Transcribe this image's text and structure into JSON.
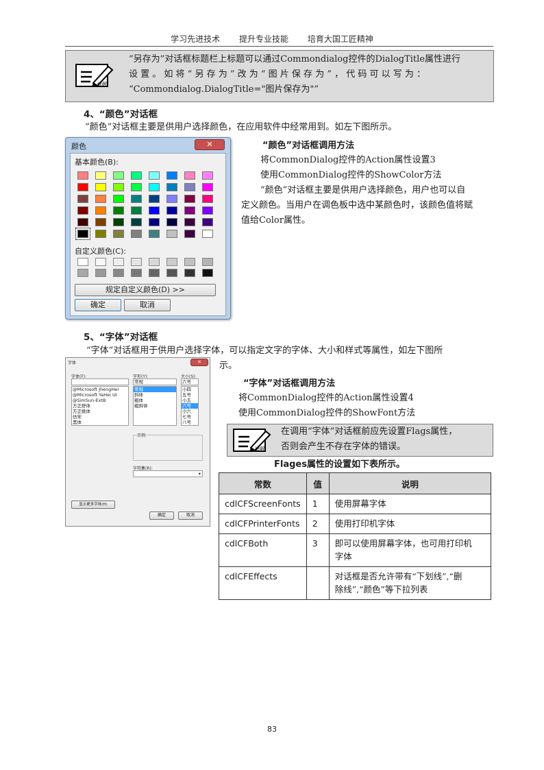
{
  "header": {
    "items": [
      "学习先进技术",
      "提升专业技能",
      "培育大国工匠精神"
    ]
  },
  "note1": {
    "lines": [
      "“另存为”对话框标题栏上标题可以通过Commondialog控件的DialogTitle属性进行",
      "设 置 。 如 将 “ 另 存 为 ” 改 为 “ 图 片 保 存 为 ” ， 代 码 可 以 写 为 ：",
      "“Commondialog.DialogTitle=\"图片保存为\"”"
    ]
  },
  "section4": {
    "heading": "4、“颜色”对话框",
    "intro": "“颜色”对话框主要是供用户选择颜色，在应用软件中经常用到。如左下图所示。",
    "method_title": "“颜色”对话框调用方法",
    "steps": [
      "将CommonDialog控件的Action属性设置3",
      "使用CommonDialog控件的ShowColor方法"
    ],
    "para": [
      "“颜色”对话框主要是供用户选择颜色，用户也可以自",
      "定义颜色。当用户在调色板中选中某颜色时，该颜色值将赋",
      "值给Color属性。"
    ]
  },
  "color_dialog": {
    "title": "颜色",
    "close": "✕",
    "basic_label": "基本颜色(B):",
    "custom_label": "自定义颜色(C):",
    "define_button": "规定自定义颜色(D) >>",
    "ok_button": "确定",
    "cancel_button": "取消",
    "basic_colors": [
      [
        "#ff8080",
        "#ffff80",
        "#80ff80",
        "#00ff80",
        "#80ffff",
        "#0080ff",
        "#ff80c0",
        "#ff80ff"
      ],
      [
        "#ff0000",
        "#ffff00",
        "#80ff00",
        "#00ff40",
        "#00ffff",
        "#0080c0",
        "#8080c0",
        "#ff00ff"
      ],
      [
        "#804040",
        "#ff8040",
        "#00ff00",
        "#008080",
        "#004080",
        "#8080ff",
        "#800040",
        "#ff0080"
      ],
      [
        "#800000",
        "#ff8000",
        "#008000",
        "#008040",
        "#0000ff",
        "#0000a0",
        "#800080",
        "#8000ff"
      ],
      [
        "#400000",
        "#804000",
        "#004000",
        "#004040",
        "#000080",
        "#000040",
        "#400040",
        "#400080"
      ],
      [
        "#000000",
        "#808000",
        "#808040",
        "#808080",
        "#408080",
        "#c0c0c0",
        "#400040",
        "#ffffff"
      ]
    ],
    "custom_colors": [
      [
        "#ffffff",
        "#f8f8f8",
        "#eeeeee",
        "#e4e4e4",
        "#d8d8d8",
        "#cccccc",
        "#c0c0c0",
        "#b4b4b4"
      ],
      [
        "#a8a8a8",
        "#999999",
        "#888888",
        "#777777",
        "#666666",
        "#555555",
        "#333333",
        "#111111"
      ]
    ]
  },
  "section5": {
    "heading": "5、“字体”对话框",
    "intro1": "“字体”对话框用于供用户选择字体，可以指定文字的字体、大小和样式等属性，如左下图所",
    "intro2": "示。",
    "method_title": "“字体”对话框调用方法",
    "steps": [
      "将CommonDialog控件的Action属性设置4",
      "使用CommonDialog控件的ShowFont方法"
    ]
  },
  "font_dialog": {
    "title": "字体",
    "font_label": "字体(F):",
    "style_label": "字形(Y):",
    "size_label": "大小(S):",
    "style_value": "常规",
    "size_value": "六号",
    "fonts": [
      "@Microsoft JhengHei",
      "@Microsoft YaHei UI",
      "@SimSun-ExtB",
      "方正舒体",
      "方正姚体",
      "仿宋",
      "黑体"
    ],
    "styles": [
      "常规",
      "斜体",
      "粗体",
      "粗斜体"
    ],
    "sizes": [
      "小四",
      "五号",
      "小五",
      "六号",
      "小六",
      "七号",
      "八号"
    ],
    "sample_label": "示例",
    "script_label": "字符集(R):",
    "more_fonts_button": "显示更多字体(H)",
    "ok_button": "确定",
    "cancel_button": "取消"
  },
  "note2": {
    "lines": [
      "在调用“字体”对话框前应先设置Flags属性，",
      "否则会产生不存在字体的错误。"
    ]
  },
  "table": {
    "caption": "Flages属性的设置如下表所示。",
    "headers": [
      "常数",
      "值",
      "说明"
    ],
    "rows": [
      {
        "c": "cdlCFScreenFonts",
        "v": "1",
        "d1": "使用屏幕字体",
        "d2": ""
      },
      {
        "c": "cdlCFPrinterFonts",
        "v": "2",
        "d1": "使用打印机字体",
        "d2": ""
      },
      {
        "c": "cdlCFBoth",
        "v": "3",
        "d1": "即可以使用屏幕字体，也可用打印机",
        "d2": "字体"
      },
      {
        "c": "cdlCFEffects",
        "v": "",
        "d1": "对话框是否允许带有“下划线”,“删",
        "d2": "除线”,“颜色”等下拉列表"
      }
    ]
  },
  "page_number": "83"
}
